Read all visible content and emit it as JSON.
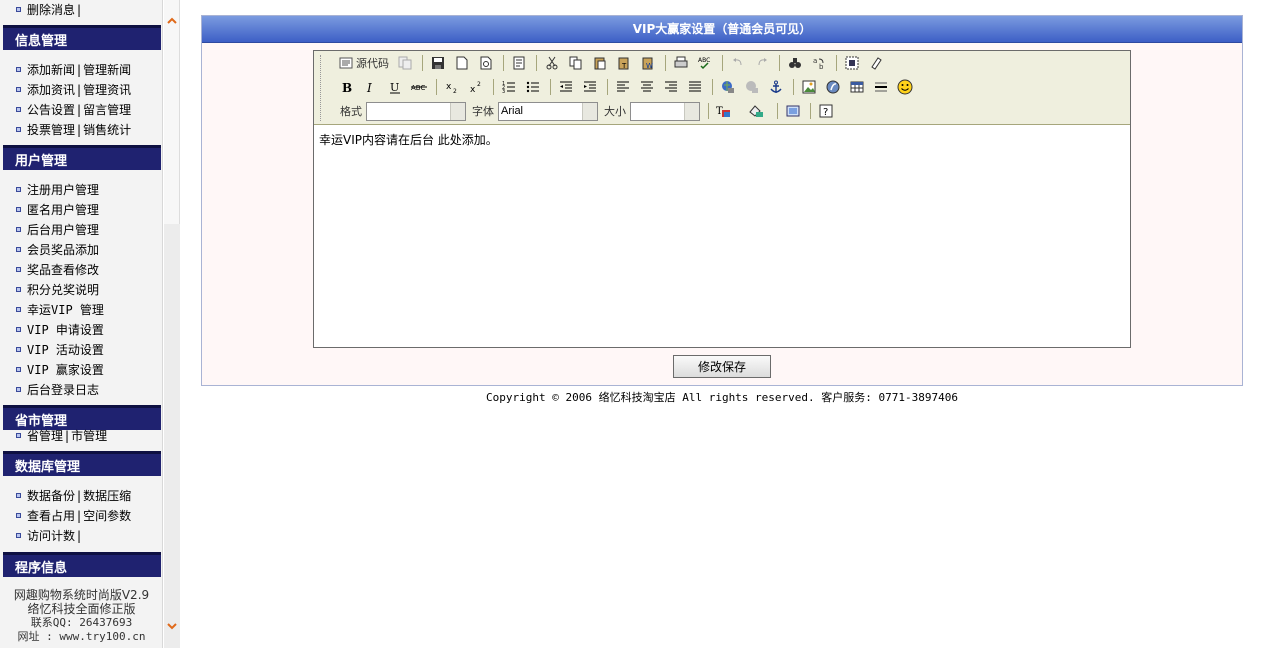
{
  "sidebar": {
    "top_item": "删除消息",
    "sections": [
      {
        "title": "信息管理",
        "rows": [
          [
            "添加新闻",
            "管理新闻"
          ],
          [
            "添加资讯",
            "管理资讯"
          ],
          [
            "公告设置",
            "留言管理"
          ],
          [
            "投票管理",
            "销售统计"
          ]
        ]
      },
      {
        "title": "用户管理",
        "rows": [
          [
            "注册用户管理"
          ],
          [
            "匿名用户管理"
          ],
          [
            "后台用户管理"
          ],
          [
            "会员奖品添加"
          ],
          [
            "奖品查看修改"
          ],
          [
            "积分兑奖说明"
          ],
          [
            "幸运VIP 管理"
          ],
          [
            "VIP 申请设置"
          ],
          [
            "VIP 活动设置"
          ],
          [
            "VIP 赢家设置"
          ],
          [
            "后台登录日志"
          ]
        ]
      },
      {
        "title": "省市管理",
        "rows": [
          [
            "省管理",
            "市管理"
          ]
        ]
      },
      {
        "title": "数据库管理",
        "rows": [
          [
            "数据备份",
            "数据压缩"
          ],
          [
            "查看占用",
            "空间参数"
          ],
          [
            "访问计数"
          ]
        ]
      }
    ],
    "program_info": {
      "title": "程序信息",
      "line1": "网趣购物系统时尚版V2.9",
      "line2": "络忆科技全面修正版",
      "qq": "联系QQ: 26437693",
      "site": "网址 : www.try100.cn"
    }
  },
  "panel": {
    "title": "VIP大赢家设置（普通会员可见）",
    "editor": {
      "source_label": "源代码",
      "format_label": "格式",
      "format_value": "",
      "font_label": "字体",
      "font_value": "Arial",
      "size_label": "大小",
      "size_value": "",
      "content": "幸运VIP内容请在后台 此处添加。"
    },
    "save_label": "修改保存"
  },
  "footer": {
    "copyright": "Copyright © 2006 络忆科技淘宝店 All rights reserved. 客户服务: 0771-3897406"
  },
  "colors": {
    "sidebar_header": "#1f2270",
    "panel_title_top": "#7b9be0",
    "panel_title_bottom": "#3d5fc6",
    "panel_bg": "#fff7f7",
    "toolbar_bg": "#efefde",
    "scroll_arrow": "#e06a1a"
  }
}
